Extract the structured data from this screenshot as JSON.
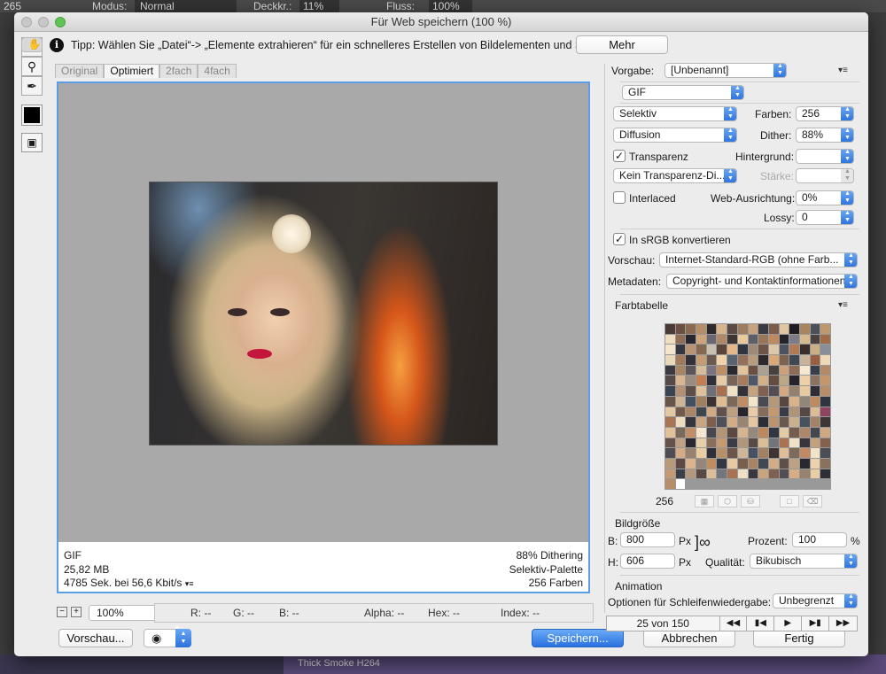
{
  "app_bar": {
    "zoom": "265",
    "mode_label": "Modus:",
    "mode_value": "Normal",
    "opacity_label": "Deckkr.:",
    "opacity_value": "11%",
    "flow_label": "Fluss:",
    "flow_value": "100%"
  },
  "dialog": {
    "title": "Für Web speichern (100 %)"
  },
  "tip": {
    "text": "Tipp: Wählen Sie „Datei“-> „Elemente extrahieren“ für ein schnelleres Erstellen von Bildelementen und SVG",
    "more_button": "Mehr"
  },
  "tools": [
    "hand-tool",
    "slice-select-tool",
    "zoom-tool",
    "eyedropper-tool"
  ],
  "view_tabs": [
    "Original",
    "Optimiert",
    "2fach",
    "4fach"
  ],
  "preview_info": {
    "format": "GIF",
    "size": "25,82 MB",
    "time": "4785 Sek. bei 56,6 Kbit/s",
    "dither": "88% Dithering",
    "palette": "Selektiv-Palette",
    "colors": "256 Farben"
  },
  "status": {
    "zoom": "100%",
    "r": "R: --",
    "g": "G: --",
    "b": "B: --",
    "alpha": "Alpha: --",
    "hex": "Hex: --",
    "index": "Index: --"
  },
  "buttons": {
    "preview": "Vorschau...",
    "save": "Speichern...",
    "cancel": "Abbrechen",
    "done": "Fertig"
  },
  "settings": {
    "preset_label": "Vorgabe:",
    "preset_value": "[Unbenannt]",
    "format": "GIF",
    "reduction": "Selektiv",
    "colors_label": "Farben:",
    "colors_value": "256",
    "dither_algo": "Diffusion",
    "dither_label": "Dither:",
    "dither_value": "88%",
    "transparency_label": "Transparenz",
    "transparency_checked": true,
    "matte_label": "Hintergrund:",
    "trans_dither": "Kein Transparenz-Di...",
    "amount_label": "Stärke:",
    "interlaced_label": "Interlaced",
    "interlaced_checked": false,
    "websnap_label": "Web-Ausrichtung:",
    "websnap_value": "0%",
    "lossy_label": "Lossy:",
    "lossy_value": "0",
    "srgb_label": "In sRGB konvertieren",
    "srgb_checked": true,
    "preview_label": "Vorschau:",
    "preview_value": "Internet-Standard-RGB (ohne Farb...",
    "metadata_label": "Metadaten:",
    "metadata_value": "Copyright- und Kontaktinformationen"
  },
  "color_table": {
    "title": "Farbtabelle",
    "count": "256",
    "colors": [
      "#4a3a35",
      "#6b4f3f",
      "#8a6a4f",
      "#b48d6b",
      "#2e2a2c",
      "#d8b48e",
      "#5a4a44",
      "#9c7b5e",
      "#c9a17c",
      "#3a3a42",
      "#7a5c48",
      "#e0c6a2",
      "#1f1d20",
      "#a8845f",
      "#4f4f5a",
      "#bf9870",
      "#f0dcc0",
      "#8f6e55",
      "#2a2630",
      "#d0a47a",
      "#6a6672",
      "#b08868",
      "#3e3434",
      "#e8c89c",
      "#5e5e68",
      "#9a7658",
      "#c08a60",
      "#24222a",
      "#7c7c86",
      "#d4b890",
      "#4a423e",
      "#a06c48",
      "#f4e6cc",
      "#363640",
      "#b79474",
      "#866852",
      "#c8c0b0",
      "#5c463a",
      "#e4b888",
      "#2e3440",
      "#9e8a74",
      "#6e5446",
      "#dcc8a8",
      "#4c5260",
      "#b07c58",
      "#3a2e2a",
      "#ccae86",
      "#8a8e98",
      "#e8d8bc",
      "#a27a5a",
      "#323038",
      "#c49c74",
      "#6a5a50",
      "#f2d2a8",
      "#5a6470",
      "#94705a",
      "#b89c7c",
      "#2c282c",
      "#d8a878",
      "#7e6250",
      "#404854",
      "#c8b49a",
      "#9a5e40",
      "#eed8b8",
      "#3c3a40",
      "#a88462",
      "#5c5456",
      "#d6bc98",
      "#7a7480",
      "#be8e64",
      "#2a2a30",
      "#e2c49a",
      "#6c5040",
      "#aca090",
      "#48403c",
      "#cca07a",
      "#8c6c54",
      "#f6e8d0",
      "#383e4a",
      "#b48a66",
      "#564a46",
      "#dab690",
      "#9c8c80",
      "#c27e54",
      "#30303a",
      "#e6cca6",
      "#786456",
      "#a67c5c",
      "#4e5866",
      "#d2b08a",
      "#644c40",
      "#bca888",
      "#26242a",
      "#ecd0aa",
      "#8a7262",
      "#c4966c",
      "#3a4450",
      "#b29070",
      "#5e4e48",
      "#dec09a",
      "#6e7078",
      "#a8704e",
      "#f0e0c4",
      "#343238",
      "#c6a27e",
      "#806050",
      "#524e54",
      "#d4a882",
      "#94806c",
      "#e8caa0",
      "#2e2c34",
      "#b88e6a",
      "#685448",
      "#ccb494",
      "#445060",
      "#a07e60",
      "#3c3230",
      "#e0bc94",
      "#7c6858",
      "#c08c66",
      "#f2e4c8",
      "#4a4a52",
      "#b49878",
      "#5a4640",
      "#d8b28a",
      "#928678",
      "#be8a60",
      "#303440",
      "#e4c8a4",
      "#745a4a",
      "#aa8666",
      "#40464e",
      "#d0aa84",
      "#62504a",
      "#bea080",
      "#28262c",
      "#eacca6",
      "#866c5a",
      "#c69870",
      "#383a46",
      "#b0947a",
      "#564844",
      "#dcbc96",
      "#8e4460",
      "#a87654",
      "#eedcc0",
      "#36343c",
      "#c8a480",
      "#7e5e4c",
      "#4e5258",
      "#d2ac86",
      "#9a8474",
      "#e6c69e",
      "#2c2e36",
      "#ba9470",
      "#6a584c",
      "#cab08e",
      "#48525e",
      "#a48266",
      "#3e3634",
      "#e2c09a",
      "#7a6a5c",
      "#c28e68",
      "#f4e6ce",
      "#46484e",
      "#b29676",
      "#5c4a42",
      "#d6b48e",
      "#96887a",
      "#bc885e",
      "#323642",
      "#e2caa6",
      "#765c4c",
      "#ac8868",
      "#42484e",
      "#cea882",
      "#665248",
      "#c0a282",
      "#2a282e",
      "#e8cea8",
      "#886e5c",
      "#c89a72",
      "#3a3c48",
      "#b2967c",
      "#5a4a46",
      "#dabe98",
      "#72747c",
      "#aa7252",
      "#f0e2c6",
      "#38363c",
      "#c4a07c",
      "#82624e",
      "#504c52",
      "#d6aa84",
      "#98826e",
      "#eacca2",
      "#30303a",
      "#b69068",
      "#6c564a",
      "#ceb696",
      "#465262",
      "#a28064",
      "#3e3432",
      "#debe98",
      "#7e6a5a",
      "#c28a64",
      "#f2e2c6",
      "#4c4c54",
      "#b69a7a",
      "#5e4a42",
      "#dab48c",
      "#948678",
      "#c08c62",
      "#343844",
      "#e6caa4",
      "#785e4e",
      "#a88464",
      "#424852",
      "#d2ac86",
      "#604e48",
      "#bca282",
      "#2a282e",
      "#ecd2ac",
      "#8a705e",
      "#c49a74",
      "#3c3e4a",
      "#b4987e",
      "#584846",
      "#dcbe98",
      "#74767e",
      "#a67454",
      "#eee0c4",
      "#3a383e",
      "#c8a47e",
      "#806050",
      "#524e54",
      "#d8ac86",
      "#96826e",
      "#e8cea4",
      "#2e2e36",
      "#b88e6a",
      "#ffffff"
    ]
  },
  "image_size": {
    "title": "Bildgröße",
    "w_label": "B:",
    "w_value": "800",
    "h_label": "H:",
    "h_value": "606",
    "unit": "Px",
    "percent_label": "Prozent:",
    "percent_value": "100",
    "percent_unit": "%",
    "quality_label": "Qualität:",
    "quality_value": "Bikubisch"
  },
  "animation": {
    "title": "Animation",
    "loop_label": "Optionen für Schleifenwiedergabe:",
    "loop_value": "Unbegrenzt",
    "frame": "25 von 150"
  },
  "bg_timeline": {
    "layer": "Thick Smoke H264"
  }
}
